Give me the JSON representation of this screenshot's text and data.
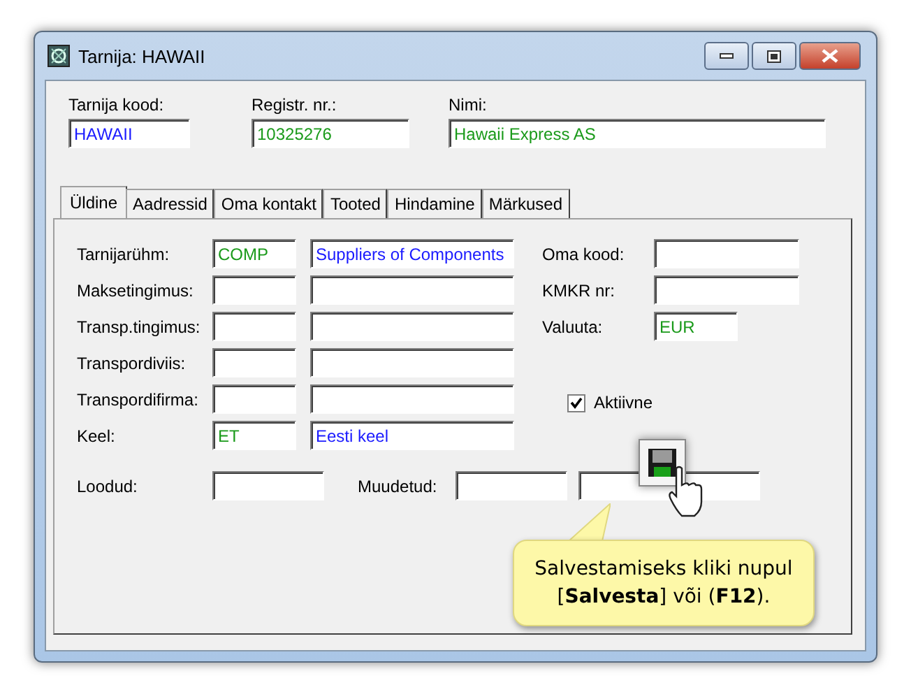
{
  "window": {
    "title": "Tarnija: HAWAII"
  },
  "header_fields": [
    {
      "label": "Tarnija kood:",
      "value": "HAWAII",
      "color": "#1a1aff"
    },
    {
      "label": "Registr. nr.:",
      "value": "10325276",
      "color": "#1a9a1a"
    },
    {
      "label": "Nimi:",
      "value": "Hawaii Express AS",
      "color": "#1a9a1a"
    }
  ],
  "tabs": [
    {
      "label": "Üldine",
      "selected": true
    },
    {
      "label": "Aadressid",
      "selected": false
    },
    {
      "label": "Oma kontakt",
      "selected": false
    },
    {
      "label": "Tooted",
      "selected": false
    },
    {
      "label": "Hindamine",
      "selected": false
    },
    {
      "label": "Märkused",
      "selected": false
    }
  ],
  "rows": [
    {
      "label": "Tarnijarühm:",
      "code": "COMP",
      "description": "Suppliers of Components"
    },
    {
      "label": "Maksetingimus:"
    },
    {
      "label": "Transp.tingimus:"
    },
    {
      "label": "Transpordiviis:"
    },
    {
      "label": "Transpordifirma:"
    },
    {
      "label": "Keel:",
      "code": "ET",
      "description": "Eesti keel"
    }
  ],
  "right_fields": [
    {
      "label": "Oma kood:"
    },
    {
      "label": "KMKR nr:"
    },
    {
      "label": "Valuuta:",
      "value": "EUR"
    }
  ],
  "active_checkbox": {
    "label": "Aktiivne",
    "checked": true
  },
  "created": {
    "label": "Loodud:"
  },
  "modified": {
    "label": "Muudetud:"
  },
  "tooltip": {
    "text": "Salvestamiseks kliki nupul [**Salvesta**] või (**F12**)."
  }
}
